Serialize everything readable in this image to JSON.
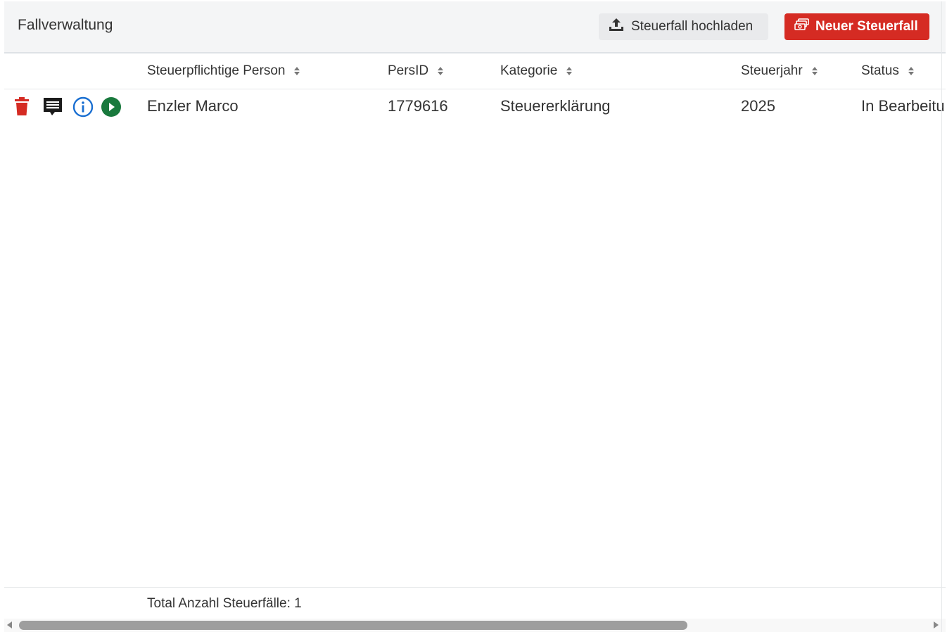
{
  "header": {
    "title": "Fallverwaltung",
    "upload_label": "Steuerfall hochladen",
    "new_label": "Neuer Steuerfall"
  },
  "table": {
    "columns": [
      "Steuerpflichtige Person",
      "PersID",
      "Kategorie",
      "Steuerjahr",
      "Status"
    ],
    "rows": [
      {
        "person": "Enzler Marco",
        "persid": "1779616",
        "kategorie": "Steuererklärung",
        "steuerjahr": "2025",
        "status": "In Bearbeitu"
      }
    ]
  },
  "footer": {
    "total_text": "Total Anzahl Steuerfälle: 1"
  },
  "icons": {
    "delete": "trash-icon",
    "comment": "comment-icon",
    "info": "info-icon",
    "open": "play-circle-icon",
    "upload": "upload-icon",
    "new": "money-stack-icon",
    "sort": "sort-icon"
  },
  "colors": {
    "primary_red": "#d52b23",
    "delete_red": "#d52b23",
    "info_blue": "#1a6fd1",
    "play_green": "#19793d",
    "header_bg": "#f4f5f6"
  }
}
